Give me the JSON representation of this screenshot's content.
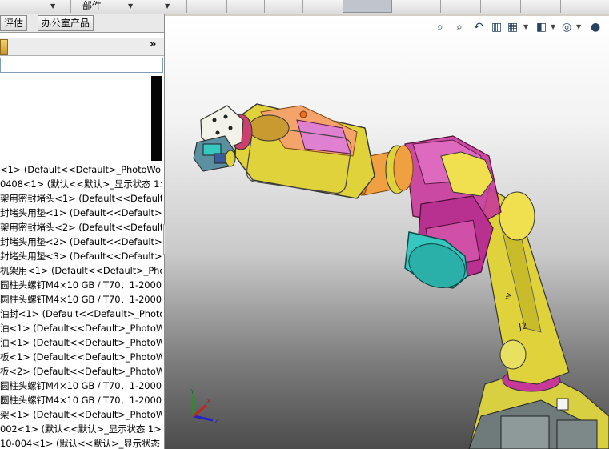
{
  "toolbar": {
    "parts_label": "部件"
  },
  "tabs": [
    {
      "label": "评估"
    },
    {
      "label": "办公室产品"
    }
  ],
  "panel": {
    "more_glyph": "»",
    "splitter_glyph": "◂"
  },
  "feature_tree": [
    "<1> (Default<<Default>_PhotoWo",
    "0408<1> (默认<<默认>_显示状态 1>",
    "架用密封堵头<1> (Default<<Default>",
    "封堵头用垫<1> (Default<<Default>_",
    "架用密封堵头<2> (Default<<Default>",
    "封堵头用垫<2> (Default<<Default>_",
    "封堵头用垫<3> (Default<<Default>_",
    "机架用<1> (Default<<Default>_Phot",
    "圆柱头螺钉M4×10 GB / T70．1-2000",
    "圆柱头螺钉M4×10 GB / T70．1-2000",
    "油封<1> (Default<<Default>_PhotoW",
    "油<1> (Default<<Default>_PhotoWo",
    "油<1> (Default<<Default>_PhotoWo",
    "板<1> (Default<<Default>_PhotoWo",
    "板<2> (Default<<Default>_PhotoWo",
    "圆柱头螺钉M4×10 GB / T70．1-2000",
    "圆柱头螺钉M4×10 GB / T70．1-2000",
    "架<1> (Default<<Default>_PhotoWo",
    "002<1> (默认<<默认>_显示状态 1>",
    "10-004<1> (默认<<默认>_显示状态"
  ],
  "view_icons": [
    "zoom-to-fit-icon",
    "zoom-area-icon",
    "previous-view-icon",
    "section-view-icon",
    "view-orientation-icon",
    "display-style-icon",
    "hide-show-icon",
    "appearance-icon"
  ],
  "model_labels": {
    "j2_label": "J2",
    "axis_label": "IV"
  },
  "triad": {
    "x": "X",
    "y": "Y",
    "z": "Z"
  },
  "colors": {
    "body_yellow": "#e0d23a",
    "joint_magenta": "#c8389a",
    "cap_cyan": "#36c8c0",
    "link_orange": "#f0a040",
    "panel_pink": "#e080d0"
  }
}
